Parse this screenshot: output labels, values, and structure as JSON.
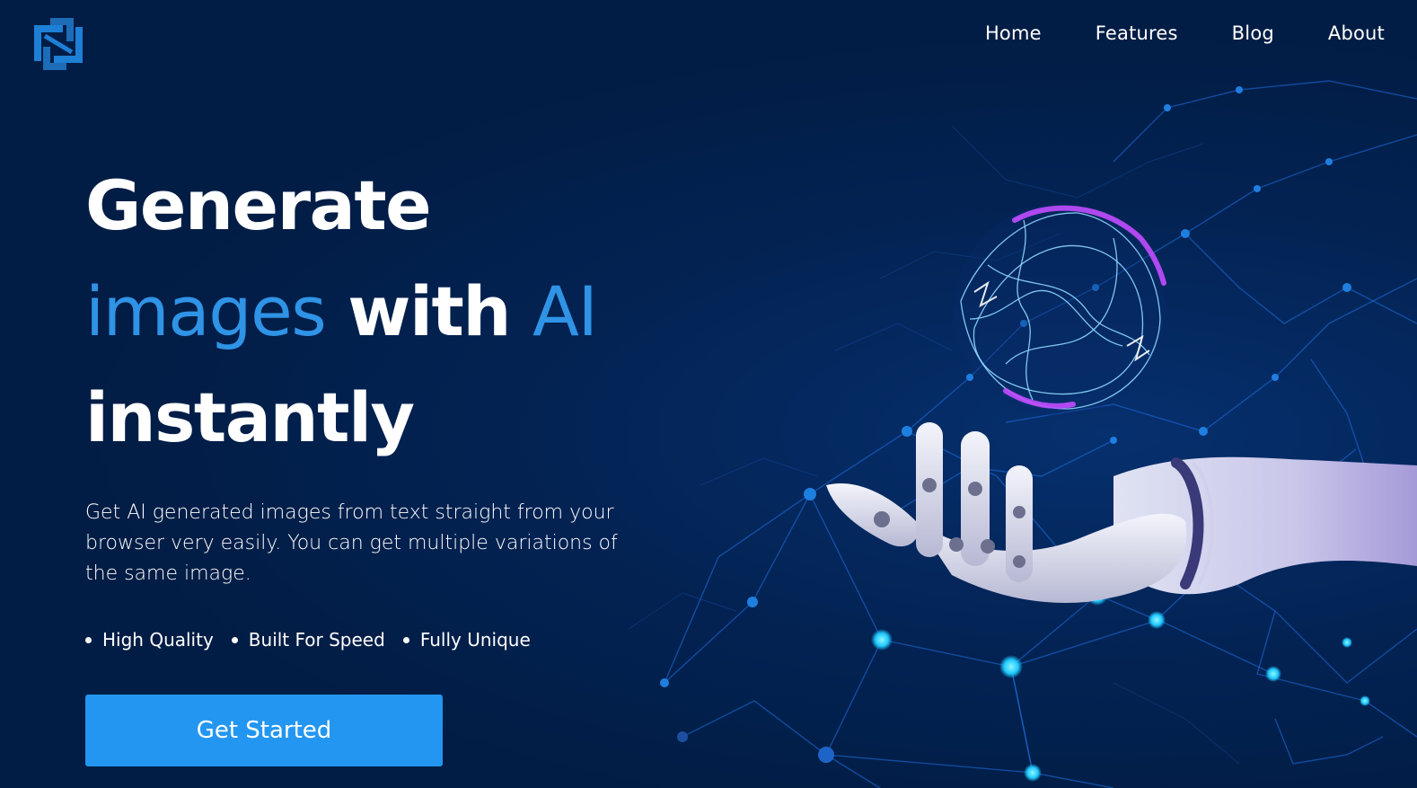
{
  "brand": {
    "logo_icon": "interlocking-squares-logo",
    "logo_color": "#1e7fd6"
  },
  "nav": {
    "items": [
      {
        "label": "Home"
      },
      {
        "label": "Features"
      },
      {
        "label": "Blog"
      },
      {
        "label": "About"
      }
    ]
  },
  "hero": {
    "headline": {
      "line1": "Generate",
      "word_images": "images",
      "word_with": "with",
      "word_ai": "AI",
      "line3": "instantly"
    },
    "description": "Get AI generated images from text straight from your browser very easily. You can get multiple variations of the same image.",
    "features": [
      {
        "label": "High Quality"
      },
      {
        "label": "Built For Speed"
      },
      {
        "label": "Fully Unique"
      }
    ],
    "cta_label": "Get Started",
    "image_icon": "robot-hand-holding-energy-orb"
  },
  "colors": {
    "background": "#021d45",
    "accent": "#2f93e6",
    "button": "#2396f1"
  }
}
